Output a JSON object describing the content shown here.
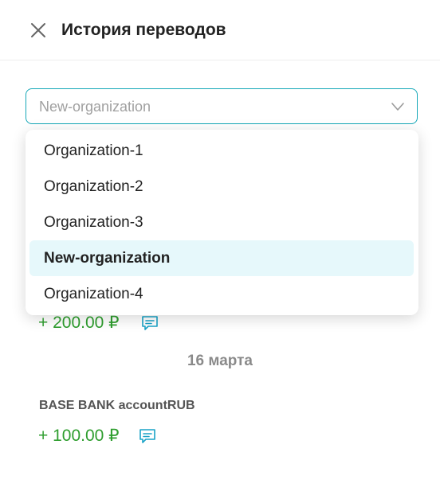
{
  "header": {
    "title": "История переводов",
    "close_icon": "close-icon"
  },
  "organization_select": {
    "value": "New-organization",
    "icon": "chevron-down-icon",
    "border_color": "#16a8b8"
  },
  "dropdown": {
    "options": [
      {
        "label": "Organization-1",
        "selected": false
      },
      {
        "label": "Organization-2",
        "selected": false
      },
      {
        "label": "Organization-3",
        "selected": false
      },
      {
        "label": "New-organization",
        "selected": true
      },
      {
        "label": "Organization-4",
        "selected": false
      }
    ],
    "selected_bg": "#e6f8fb"
  },
  "transfers": {
    "first_partial": {
      "amount": "+ 200.00 ₽",
      "icon": "comment-icon"
    },
    "date_separator": "16 марта",
    "item": {
      "account": "BASE BANK accountRUB",
      "amount": "+ 100.00 ₽",
      "icon": "comment-icon"
    },
    "amount_color": "#2f9e2f"
  }
}
